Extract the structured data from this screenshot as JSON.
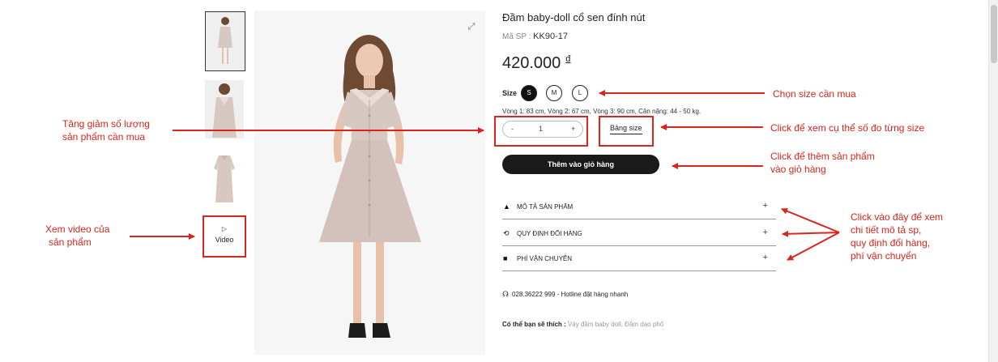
{
  "product": {
    "title": "Đầm baby-doll cổ sen đính nút",
    "sku_label": "Mã SP :",
    "sku": "KK90-17",
    "price": "420.000",
    "currency": "đ",
    "size_label": "Size",
    "sizes": [
      "S",
      "M",
      "L"
    ],
    "selected_size": "S",
    "measurements": "Vòng 1: 83 cm, Vòng 2: 67 cm, Vòng 3: 90 cm, Cân nặng: 44 - 50 kg.",
    "quantity": "1",
    "qty_minus": "-",
    "qty_plus": "+",
    "size_guide": "Bảng size",
    "add_to_cart": "Thêm vào giỏ hàng"
  },
  "gallery": {
    "video_label": "Video"
  },
  "accordion": [
    {
      "icon": "dress-icon",
      "label": "MÔ TẢ SẢN PHẨM",
      "toggle": "+"
    },
    {
      "icon": "exchange-icon",
      "label": "QUY ĐỊNH ĐỔI HÀNG",
      "toggle": "+"
    },
    {
      "icon": "truck-icon",
      "label": "PHÍ VẬN CHUYỂN",
      "toggle": "+"
    }
  ],
  "hotline": "028.36222 999 - Hotline đặt hàng nhanh",
  "suggest": {
    "label": "Có thể bạn sẽ thích :",
    "links": "Váy đầm baby doll, Đầm dạo phố"
  },
  "annotations": {
    "qty_note_1": "Tăng giảm số lượng",
    "qty_note_2": "sản phẩm cần mua",
    "video_note_1": "Xem video của",
    "video_note_2": "sản phẩm",
    "size_note": "Chọn size cần mua",
    "guide_note": "Click để xem cụ thể số đo từng size",
    "cart_note_1": "Click để thêm sản phẩm",
    "cart_note_2": "vào giỏ hàng",
    "acc_note_1": "Click vào đây để xem",
    "acc_note_2": "chi tiết mô tả sp,",
    "acc_note_3": "quy định đổi hàng,",
    "acc_note_4": "phí vận chuyển"
  },
  "colors": {
    "annotation_red": "#d9251c",
    "button_dark": "#1a1a1a",
    "dress": "#d8c8c2"
  }
}
